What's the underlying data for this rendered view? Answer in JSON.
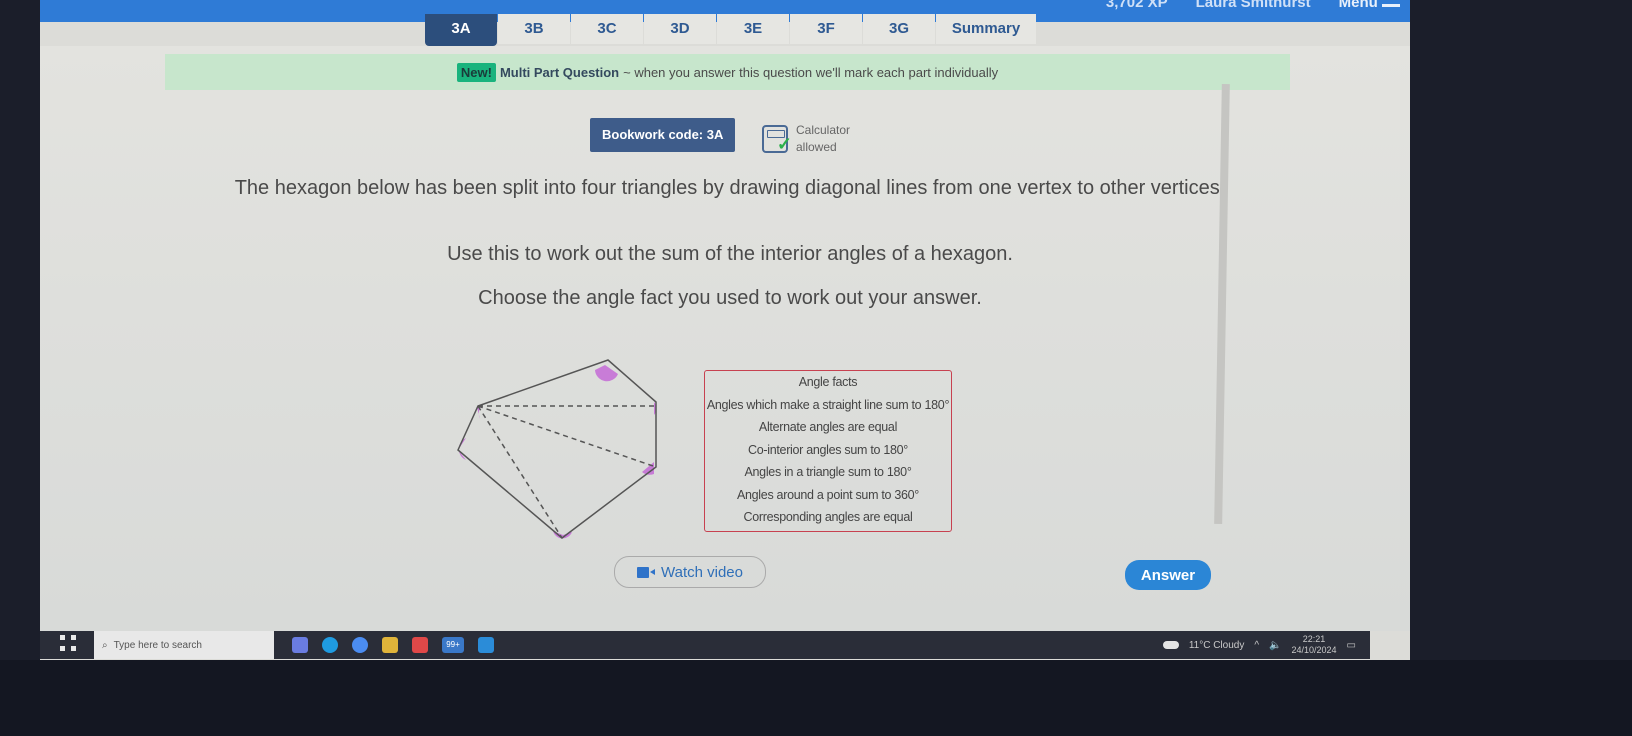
{
  "topbar": {
    "xp": "3,702 XP",
    "user": "Laura Smithurst",
    "menu_label": "Menu"
  },
  "tabs": [
    {
      "label": "3A",
      "active": true
    },
    {
      "label": "3B"
    },
    {
      "label": "3C"
    },
    {
      "label": "3D"
    },
    {
      "label": "3E"
    },
    {
      "label": "3F"
    },
    {
      "label": "3G"
    },
    {
      "label": "Summary"
    }
  ],
  "banner": {
    "badge": "New!",
    "title": "Multi Part Question",
    "text": "~ when you answer this question we'll mark each part individually"
  },
  "bookwork": {
    "label": "Bookwork code: 3A"
  },
  "calculator": {
    "line1": "Calculator",
    "line2": "allowed"
  },
  "question": {
    "p1": "The hexagon below has been split into four triangles by drawing diagonal lines from one vertex to other vertices.",
    "p2": "Use this to work out the sum of the interior angles of a hexagon.",
    "p3": "Choose the angle fact you used to work out your answer."
  },
  "angle_facts": {
    "title": "Angle facts",
    "items": [
      "Angles which make a straight line sum to 180°",
      "Alternate angles are equal",
      "Co-interior angles sum to 180°",
      "Angles in a triangle sum to 180°",
      "Angles around a point sum to 360°",
      "Corresponding angles are equal"
    ]
  },
  "buttons": {
    "watch_video": "Watch video",
    "answer": "Answer"
  },
  "colors": {
    "accent": "#2b86d6",
    "tab_active": "#2c4e7c",
    "angle_marker": "#c46bd6",
    "facts_border": "#c74150",
    "banner": "#c7e6cc"
  },
  "taskbar": {
    "search_placeholder": "Type here to search",
    "badge": "99+",
    "weather": "11°C Cloudy",
    "time": "22:21",
    "date": "24/10/2024"
  }
}
